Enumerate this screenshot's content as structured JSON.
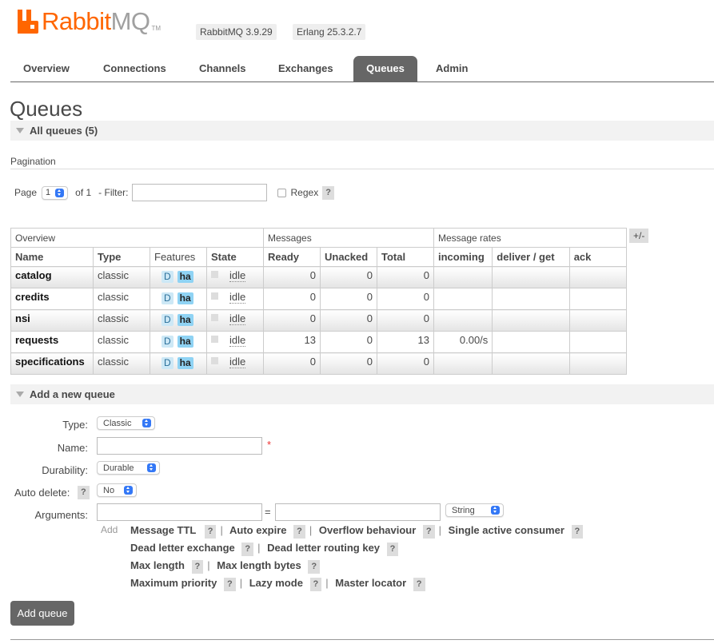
{
  "header": {
    "logo_rabbit": "Rabbit",
    "logo_mq": "MQ",
    "logo_tm": "TM",
    "rabbitmq_version": "RabbitMQ 3.9.29",
    "erlang_version": "Erlang 25.3.2.7"
  },
  "nav": {
    "tabs": [
      {
        "label": "Overview"
      },
      {
        "label": "Connections"
      },
      {
        "label": "Channels"
      },
      {
        "label": "Exchanges"
      },
      {
        "label": "Queues"
      },
      {
        "label": "Admin"
      }
    ],
    "active": "Queues"
  },
  "page_title": "Queues",
  "all_queues": {
    "title": "All queues (5)"
  },
  "pagination": {
    "label": "Pagination",
    "page_label": "Page",
    "page_value": "1",
    "of_label": "of 1",
    "filter_label": "- Filter:",
    "filter_value": "",
    "regex_label": "Regex",
    "help": "?"
  },
  "table": {
    "groups": [
      "Overview",
      "Messages",
      "Message rates"
    ],
    "plus_minus": "+/-",
    "columns": [
      "Name",
      "Type",
      "Features",
      "State",
      "Ready",
      "Unacked",
      "Total",
      "incoming",
      "deliver / get",
      "ack"
    ],
    "rows": [
      {
        "name": "catalog",
        "type": "classic",
        "f1": "D",
        "f2": "ha",
        "state": "idle",
        "ready": "0",
        "unacked": "0",
        "total": "0",
        "incoming": "",
        "deliver": "",
        "ack": ""
      },
      {
        "name": "credits",
        "type": "classic",
        "f1": "D",
        "f2": "ha",
        "state": "idle",
        "ready": "0",
        "unacked": "0",
        "total": "0",
        "incoming": "",
        "deliver": "",
        "ack": ""
      },
      {
        "name": "nsi",
        "type": "classic",
        "f1": "D",
        "f2": "ha",
        "state": "idle",
        "ready": "0",
        "unacked": "0",
        "total": "0",
        "incoming": "",
        "deliver": "",
        "ack": ""
      },
      {
        "name": "requests",
        "type": "classic",
        "f1": "D",
        "f2": "ha",
        "state": "idle",
        "ready": "13",
        "unacked": "0",
        "total": "13",
        "incoming": "0.00/s",
        "deliver": "",
        "ack": ""
      },
      {
        "name": "specifications",
        "type": "classic",
        "f1": "D",
        "f2": "ha",
        "state": "idle",
        "ready": "0",
        "unacked": "0",
        "total": "0",
        "incoming": "",
        "deliver": "",
        "ack": ""
      }
    ]
  },
  "add_queue": {
    "title": "Add a new queue",
    "type_label": "Type:",
    "type_value": "Classic",
    "name_label": "Name:",
    "name_value": "",
    "required_mark": "*",
    "durability_label": "Durability:",
    "durability_value": "Durable",
    "auto_delete_label": "Auto delete:",
    "auto_delete_value": "No",
    "arguments_label": "Arguments:",
    "equals": "=",
    "arg_type_value": "String",
    "add_label": "Add",
    "argument_links": [
      [
        "Message TTL",
        "Auto expire",
        "Overflow behaviour",
        "Single active consumer"
      ],
      [
        "Dead letter exchange",
        "Dead letter routing key"
      ],
      [
        "Max length",
        "Max length bytes"
      ],
      [
        "Maximum priority",
        "Lazy mode",
        "Master locator"
      ]
    ],
    "submit_label": "Add queue"
  }
}
